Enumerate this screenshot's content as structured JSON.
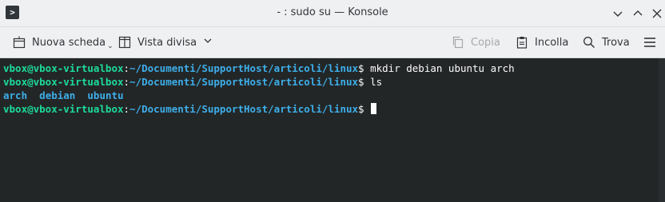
{
  "window": {
    "title": "- : sudo su — Konsole"
  },
  "toolbar": {
    "new_tab_label": "Nuova scheda",
    "split_view_label": "Vista divisa",
    "copy_label": "Copia",
    "paste_label": "Incolla",
    "find_label": "Trova"
  },
  "terminal": {
    "lines": [
      {
        "user": "vbox@vbox-virtualbox",
        "sep": ":",
        "path": "~/Documenti/SupportHost/articoli/linux",
        "prompt": "$",
        "command": " mkdir debian ubuntu arch"
      },
      {
        "user": "vbox@vbox-virtualbox",
        "sep": ":",
        "path": "~/Documenti/SupportHost/articoli/linux",
        "prompt": "$",
        "command": " ls"
      },
      {
        "dirs": [
          "arch",
          "debian",
          "ubuntu"
        ]
      },
      {
        "user": "vbox@vbox-virtualbox",
        "sep": ":",
        "path": "~/Documenti/SupportHost/articoli/linux",
        "prompt": "$",
        "command": ""
      }
    ]
  },
  "colors": {
    "user": "#1cdc9a",
    "path": "#3daee9",
    "background": "#232627",
    "text": "#fcfcfc"
  }
}
